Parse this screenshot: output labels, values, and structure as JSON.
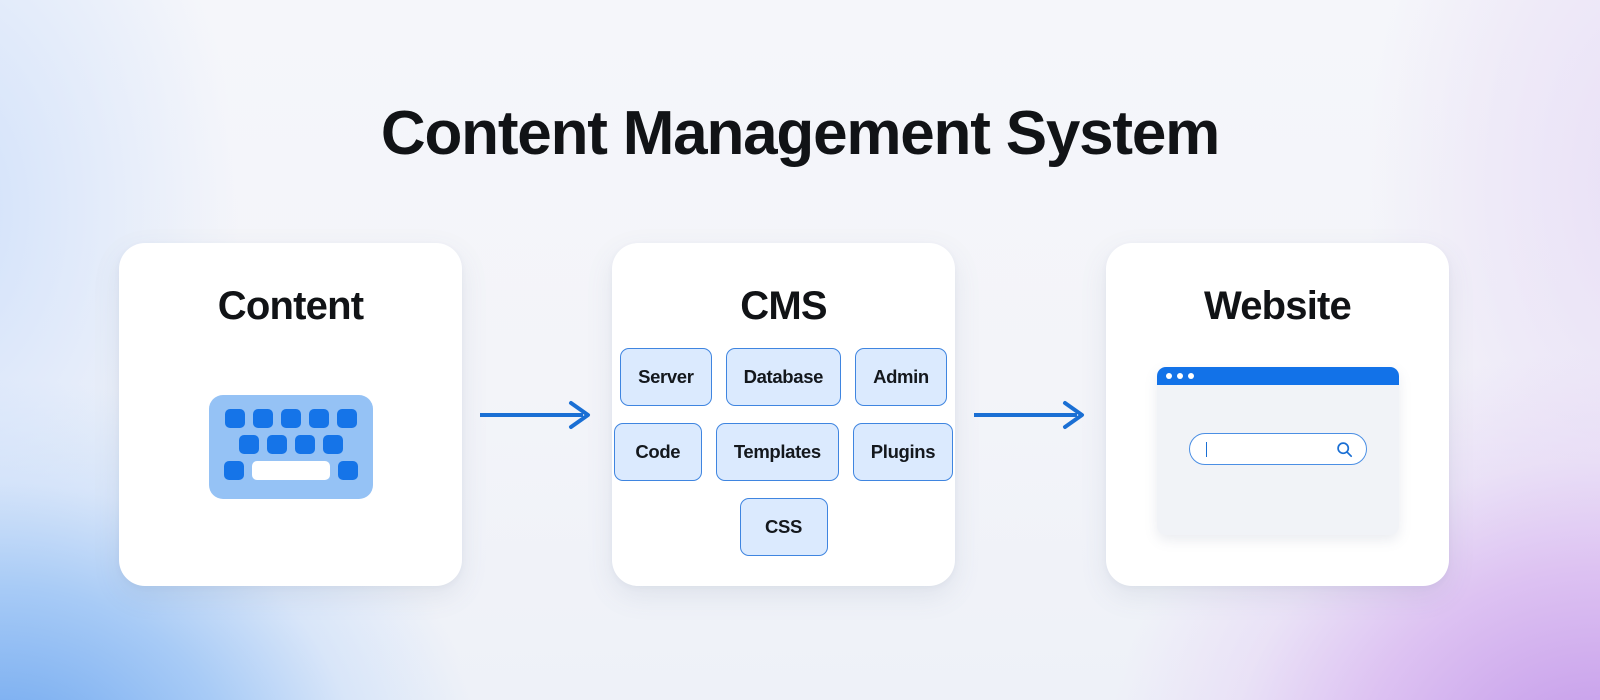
{
  "page": {
    "title": "Content Management System",
    "accent_blue": "#1272e8",
    "tag_fill": "#dbeafe",
    "tag_border": "#3f85e0",
    "background_left": "#7db0f1",
    "background_right": "#c9a0ea",
    "background_base": "#f4f5f9"
  },
  "flow": {
    "arrow_1": "arrow-right",
    "arrow_2": "arrow-right"
  },
  "cards": [
    {
      "id": "content",
      "title": "Content",
      "icon": "keyboard-icon"
    },
    {
      "id": "cms",
      "title": "CMS",
      "tag_rows": [
        [
          "Server",
          "Database",
          "Admin"
        ],
        [
          "Code",
          "Templates",
          "Plugins"
        ],
        [
          "CSS"
        ]
      ]
    },
    {
      "id": "website",
      "title": "Website",
      "browser": {
        "dots": 3,
        "search_value": "",
        "search_icon": "magnifier-icon"
      }
    }
  ]
}
